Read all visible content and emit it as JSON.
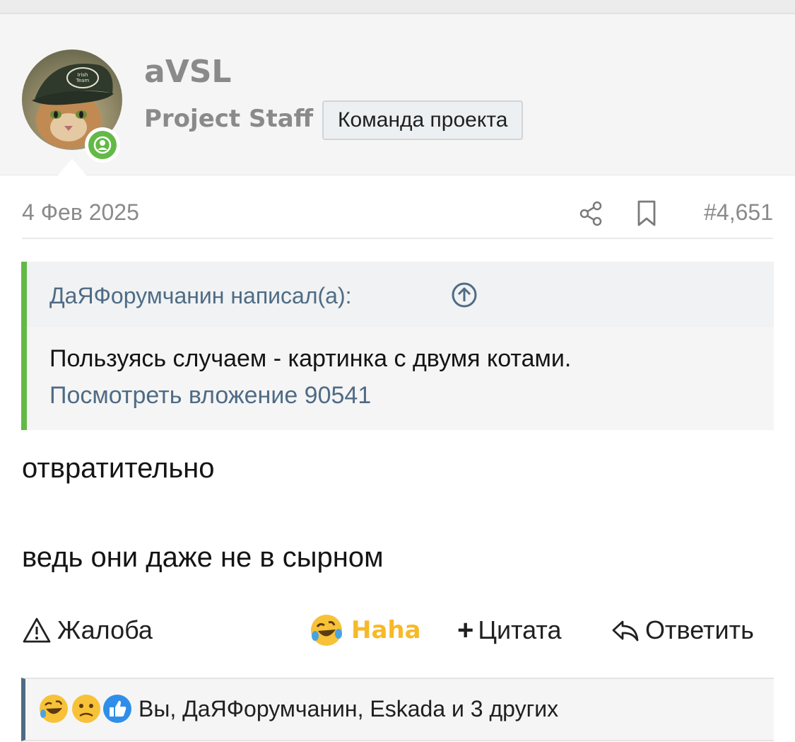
{
  "user": {
    "name": "aVSL",
    "title": "Project Staff",
    "banner": "Команда проекта",
    "cap_text": "Irish\nBrewing\nTeam"
  },
  "post": {
    "date": "4 Фев 2025",
    "number": "#4,651",
    "quote": {
      "author": "ДаЯФорумчанин написал(а):",
      "text": "Пользуясь случаем - картинка с двумя котами.",
      "link": "Посмотреть вложение 90541"
    },
    "body": [
      "отвратительно",
      "ведь они даже не в сырном"
    ]
  },
  "actions": {
    "report": "Жалоба",
    "reaction": "Haha",
    "quote": "Цитата",
    "reply": "Ответить"
  },
  "reactions": {
    "summary": "Вы, ДаЯФорумчанин, Eskada и 3 других",
    "icons": [
      "laughing-emoji",
      "sad-emoji",
      "like-emoji"
    ]
  },
  "colors": {
    "online": "#63b946",
    "quote_border": "#63b946",
    "link": "#4f6b85",
    "haha": "#f7b928",
    "muted": "#8a8a8a"
  }
}
